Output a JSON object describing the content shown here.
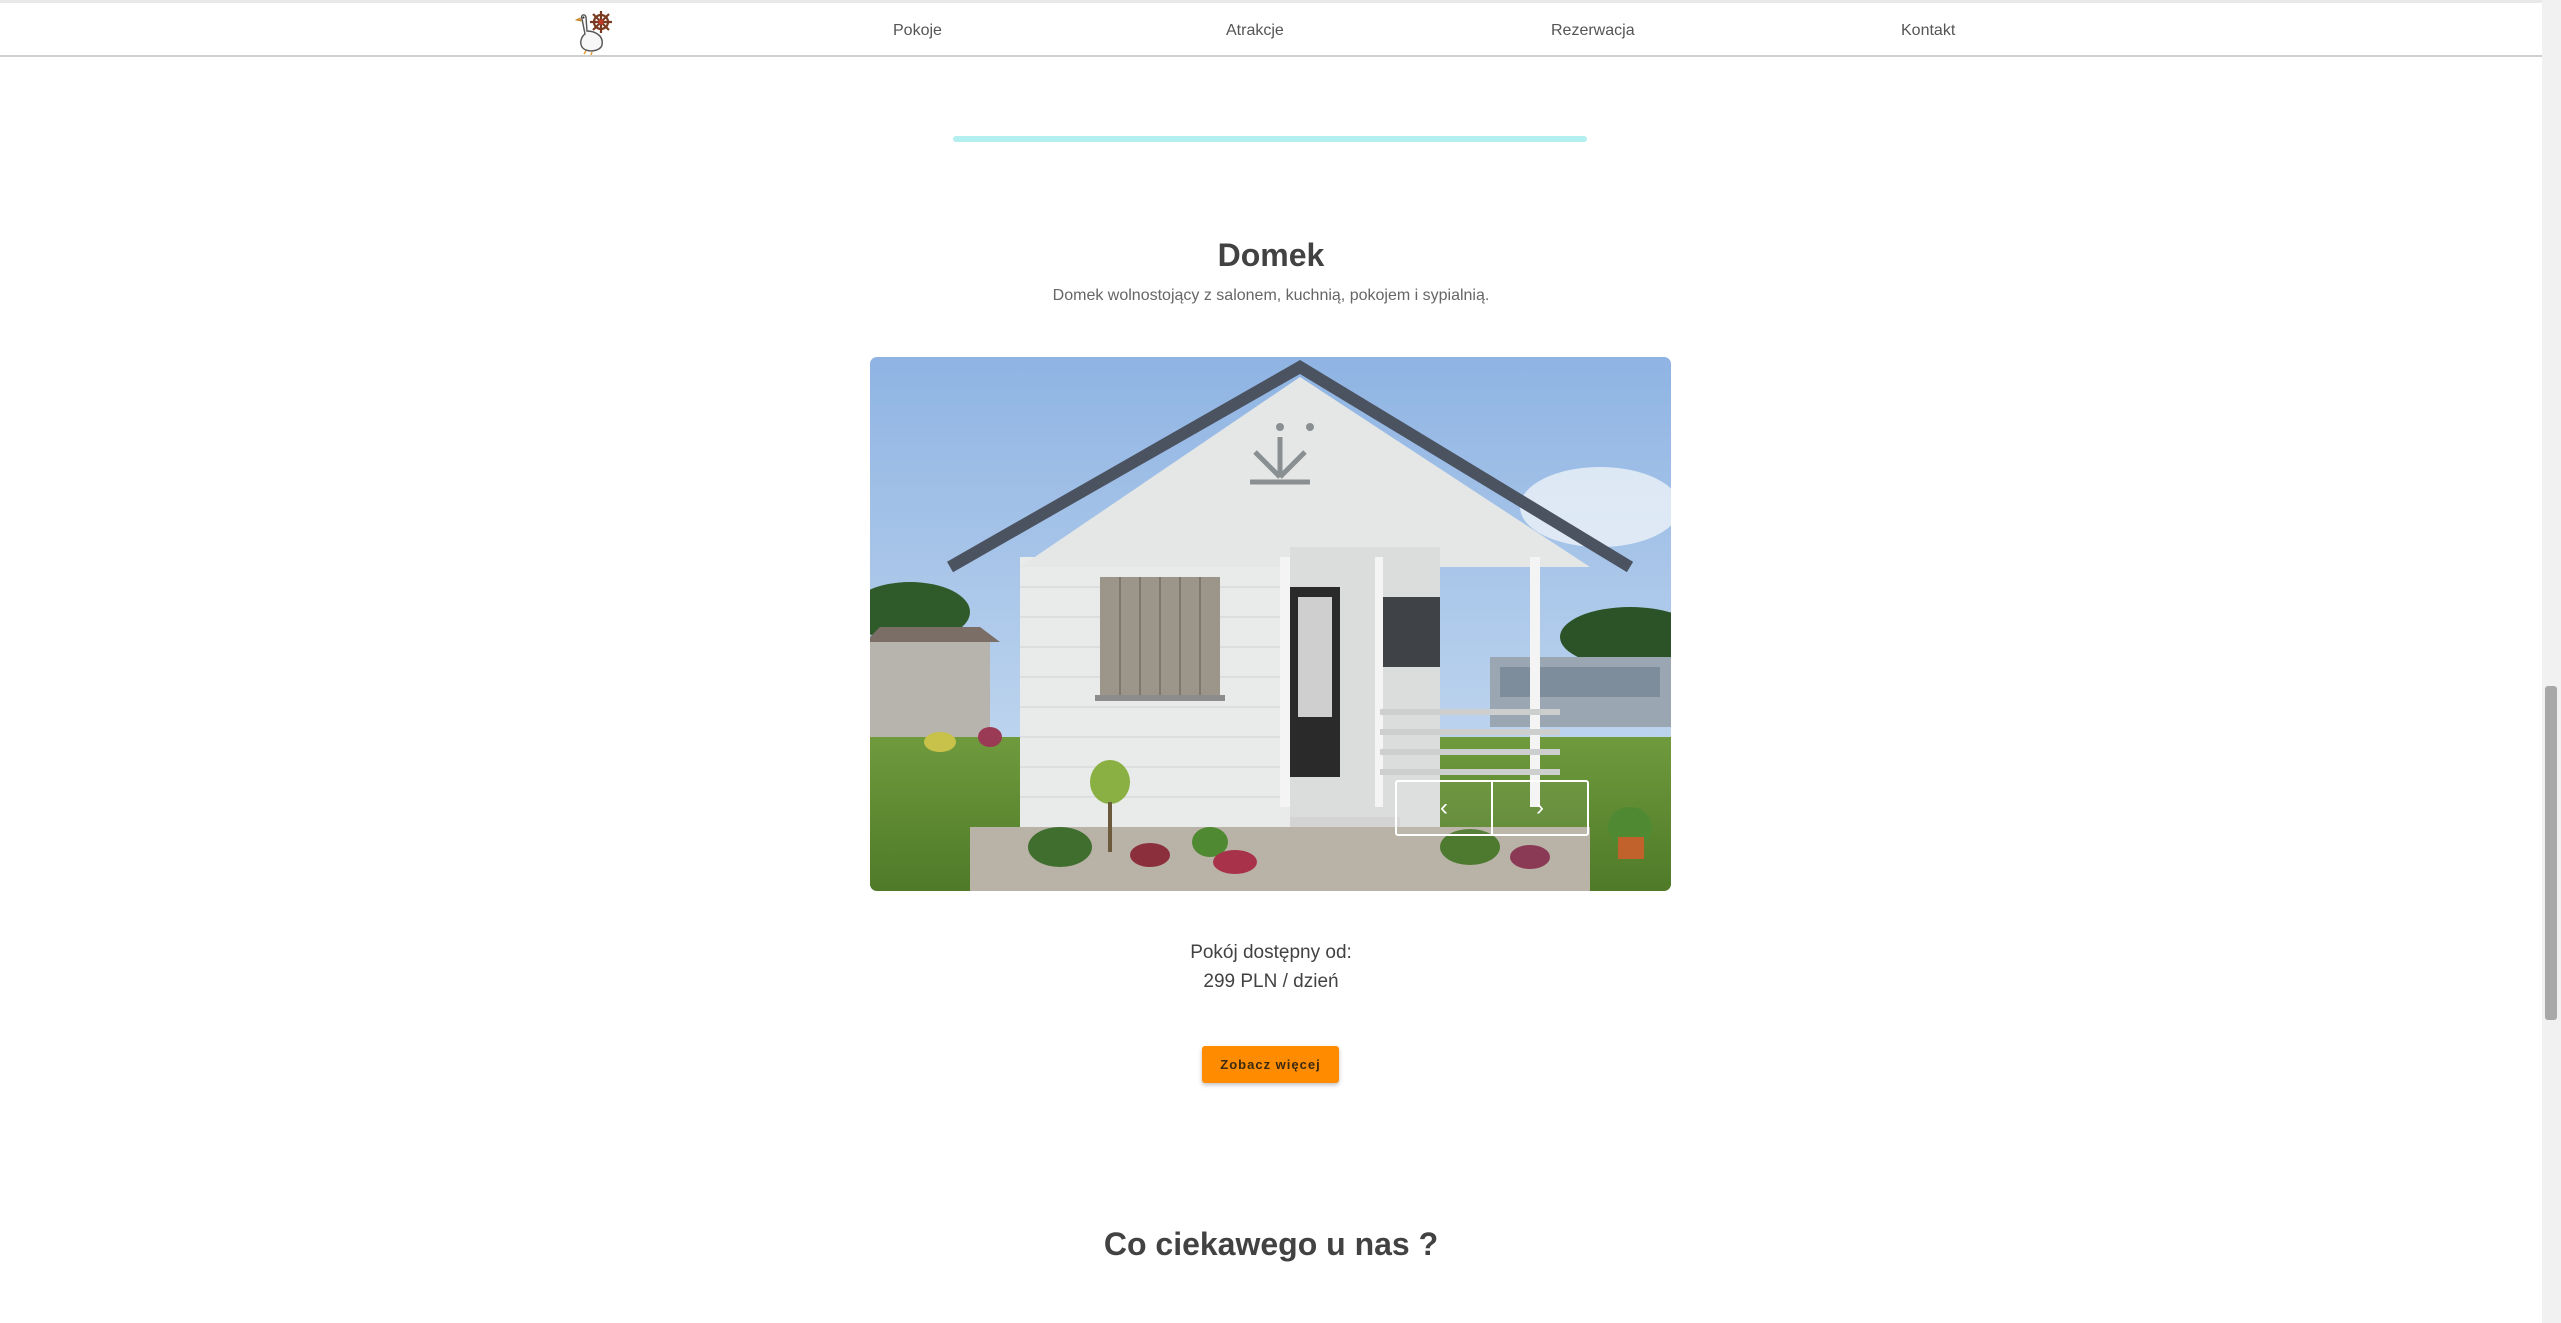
{
  "navbar": {
    "logo_icon": "goose-with-ship-wheel-logo",
    "links": [
      {
        "label": "Pokoje"
      },
      {
        "label": "Atrakcje"
      },
      {
        "label": "Rezerwacja"
      },
      {
        "label": "Kontakt"
      }
    ]
  },
  "colors": {
    "divider": "#b2efee",
    "accent": "#ff8c00"
  },
  "room": {
    "title": "Domek",
    "description": "Domek wolnostojący z salonem, kuchnią, pokojem i sypialnią.",
    "image_description": "White wooden cottage with grey roof and porch, shrubs and flowers in front, blue sky",
    "carousel": {
      "prev_icon": "chevron-left-icon",
      "next_icon": "chevron-right-icon",
      "prev_glyph": "‹",
      "next_glyph": "›"
    },
    "price_label": "Pokój dostępny od:",
    "price_value": "299 PLN / dzień",
    "cta_label": "Zobacz więcej"
  },
  "next_section": {
    "title": "Co ciekawego u nas ?"
  }
}
